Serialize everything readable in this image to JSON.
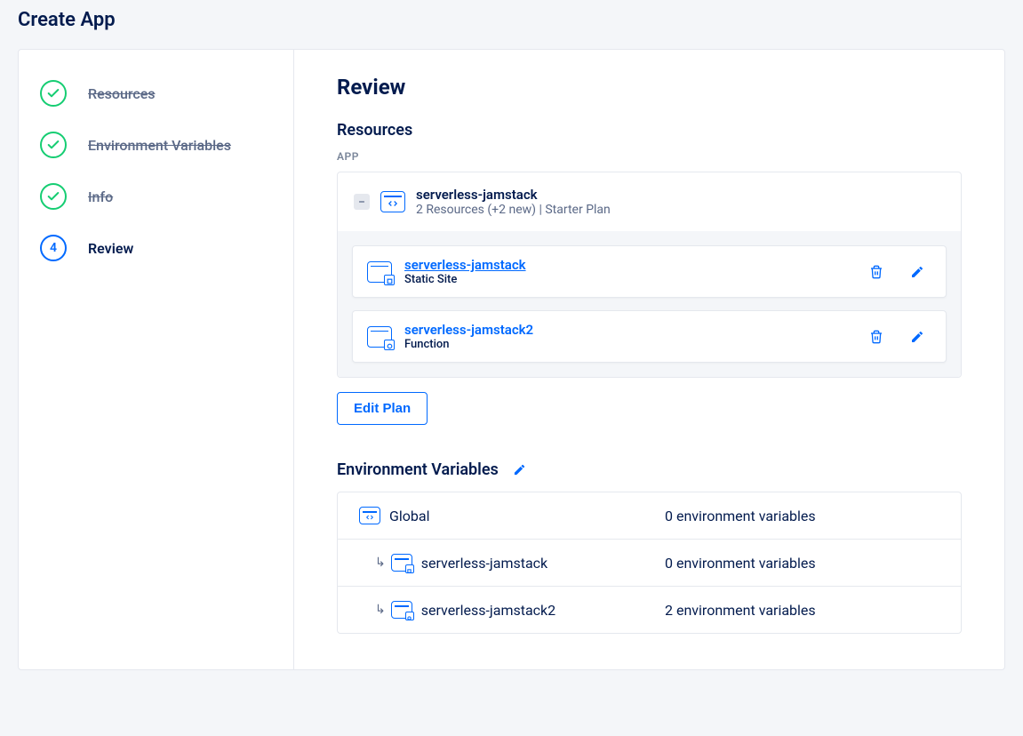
{
  "pageTitle": "Create App",
  "sidebar": {
    "steps": [
      {
        "label": "Resources",
        "state": "done"
      },
      {
        "label": "Environment Variables",
        "state": "done"
      },
      {
        "label": "Info",
        "state": "done"
      },
      {
        "label": "Review",
        "state": "active",
        "number": "4"
      }
    ]
  },
  "main": {
    "heading": "Review",
    "resourcesSection": {
      "title": "Resources",
      "appLabel": "APP",
      "app": {
        "name": "serverless-jamstack",
        "subtitle": "2 Resources (+2 new) | Starter Plan"
      },
      "children": [
        {
          "name": "serverless-jamstack",
          "type": "Static Site",
          "underline": true
        },
        {
          "name": "serverless-jamstack2",
          "type": "Function",
          "underline": false
        }
      ],
      "editPlanLabel": "Edit Plan"
    },
    "envSection": {
      "title": "Environment Variables",
      "rows": [
        {
          "name": "Global",
          "value": "0 environment variables",
          "indent": false,
          "iconType": "code"
        },
        {
          "name": "serverless-jamstack",
          "value": "0 environment variables",
          "indent": true,
          "iconType": "static"
        },
        {
          "name": "serverless-jamstack2",
          "value": "2 environment variables",
          "indent": true,
          "iconType": "function"
        }
      ]
    }
  }
}
